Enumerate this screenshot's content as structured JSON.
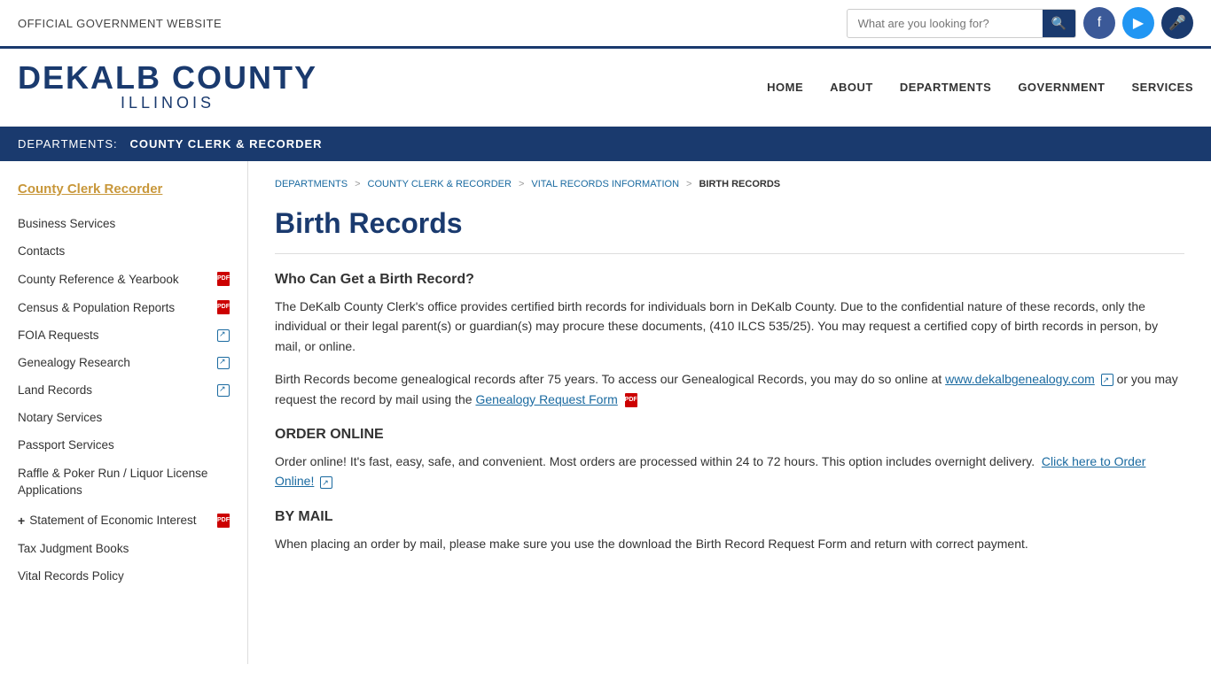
{
  "topbar": {
    "official_text": "OFFICIAL GOVERNMENT WEBSITE",
    "search_placeholder": "What are you looking for?"
  },
  "header": {
    "logo_main": "DEKALB COUNTY",
    "logo_sub": "ILLINOIS",
    "nav": [
      {
        "label": "HOME",
        "id": "home"
      },
      {
        "label": "ABOUT",
        "id": "about"
      },
      {
        "label": "DEPARTMENTS",
        "id": "departments"
      },
      {
        "label": "GOVERNMENT",
        "id": "government"
      },
      {
        "label": "SERVICES",
        "id": "services"
      }
    ]
  },
  "dept_bar": {
    "label": "DEPARTMENTS:",
    "name": "COUNTY CLERK & RECORDER"
  },
  "sidebar": {
    "title": "County Clerk Recorder",
    "items": [
      {
        "label": "Business Services",
        "icon": null,
        "plus": false
      },
      {
        "label": "Contacts",
        "icon": null,
        "plus": false
      },
      {
        "label": "County Reference & Yearbook",
        "icon": "pdf",
        "plus": false
      },
      {
        "label": "Census & Population Reports",
        "icon": "pdf",
        "plus": false
      },
      {
        "label": "FOIA Requests",
        "icon": "ext",
        "plus": false
      },
      {
        "label": "Genealogy Research",
        "icon": "ext",
        "plus": false
      },
      {
        "label": "Land Records",
        "icon": "ext",
        "plus": false
      },
      {
        "label": "Notary Services",
        "icon": null,
        "plus": false
      },
      {
        "label": "Passport Services",
        "icon": null,
        "plus": false
      },
      {
        "label": "Raffle & Poker Run / Liquor License Applications",
        "icon": null,
        "plus": false
      },
      {
        "label": "Statement of Economic Interest",
        "icon": "pdf",
        "plus": true
      },
      {
        "label": "Tax Judgment Books",
        "icon": null,
        "plus": false
      },
      {
        "label": "Vital Records Policy",
        "icon": null,
        "plus": false
      }
    ]
  },
  "breadcrumb": {
    "items": [
      {
        "label": "DEPARTMENTS",
        "id": "bc-departments"
      },
      {
        "label": "COUNTY CLERK & RECORDER",
        "id": "bc-clerk"
      },
      {
        "label": "VITAL RECORDS INFORMATION",
        "id": "bc-vital"
      },
      {
        "label": "BIRTH RECORDS",
        "id": "bc-birth",
        "current": true
      }
    ]
  },
  "main": {
    "page_title": "Birth Records",
    "section1_heading": "Who Can Get a Birth Record?",
    "section1_para1": "The DeKalb County Clerk's office provides certified birth records for individuals born in DeKalb County. Due to the confidential nature of these records, only the individual or their legal parent(s) or guardian(s) may procure these documents, (410 ILCS 535/25). You may request a certified copy of birth records in person, by mail, or online.",
    "section1_para2_before": "Birth Records become genealogical records after 75 years. To access our Genealogical Records, you may do so online at ",
    "genealogy_link": "www.dekalbgenealogy.com",
    "section1_para2_middle": " or you may request the record by mail using the ",
    "genealogy_form_link": "Genealogy Request Form",
    "section2_heading": "ORDER ONLINE",
    "section2_para": "Order online! It's fast, easy, safe, and convenient. Most orders are processed within 24 to 72 hours. This option includes overnight delivery.",
    "order_link": "Click here to Order Online!",
    "section3_heading": "BY MAIL",
    "section3_para": "When placing an order by mail, please make sure you use the download the Birth Record Request Form and return with correct payment."
  }
}
